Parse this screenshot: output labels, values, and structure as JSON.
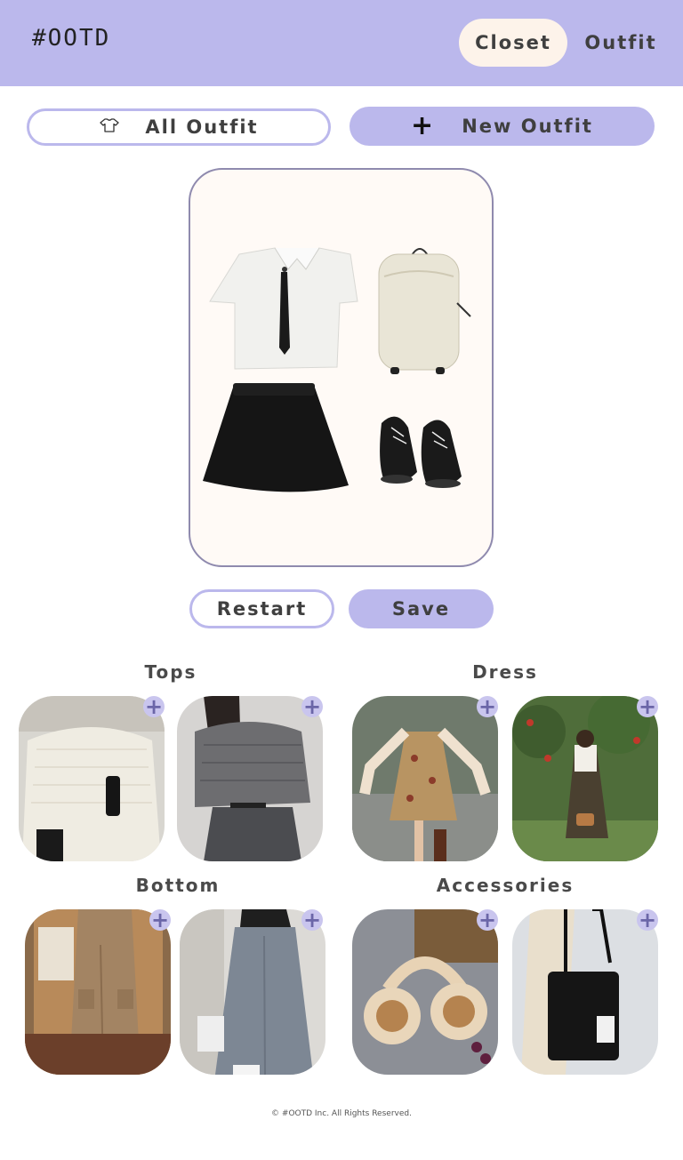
{
  "header": {
    "logo": "#OOTD",
    "nav": [
      {
        "label": "Closet",
        "active": true
      },
      {
        "label": "Outfit",
        "active": false
      }
    ]
  },
  "actions": {
    "all_outfit_label": "All Outfit",
    "new_outfit_label": "New Outfit"
  },
  "canvas": {
    "items": [
      "white-shirt-with-tie",
      "cream-backpack",
      "black-skirt",
      "black-platform-shoes"
    ]
  },
  "controls": {
    "restart_label": "Restart",
    "save_label": "Save"
  },
  "categories": [
    {
      "title": "Tops",
      "items": [
        "cream-knit-sweater",
        "grey-off-shoulder-sweater"
      ]
    },
    {
      "title": "Dress",
      "items": [
        "floral-mini-dress",
        "olive-pinafore-dress"
      ]
    },
    {
      "title": "Bottom",
      "items": [
        "khaki-cargo-pants",
        "wide-leg-jeans"
      ]
    },
    {
      "title": "Accessories",
      "items": [
        "fluffy-earmuffs",
        "black-tote-bag"
      ]
    }
  ],
  "colors": {
    "accent": "#bbb8ec",
    "active_nav": "#fdf3ea",
    "canvas_bg": "#fffaf6"
  },
  "footer": {
    "copyright": "© #OOTD Inc. All Rights Reserved."
  }
}
